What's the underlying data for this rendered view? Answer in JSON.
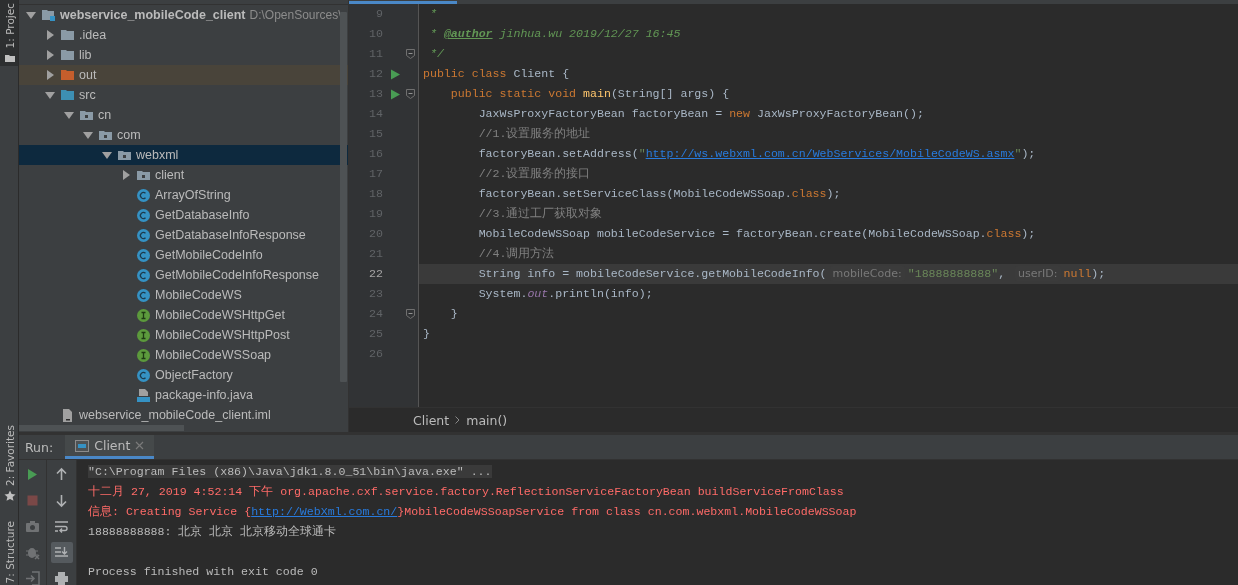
{
  "tool_windows": [
    {
      "label": "1: Projec",
      "selected": true
    },
    {
      "label": "2: Favorites",
      "selected": false
    },
    {
      "label": "7: Structure",
      "selected": false
    }
  ],
  "project_tree": {
    "children": [
      {
        "label": "webservice_mobileCode_client",
        "location": "D:\\OpenSources\\",
        "kind": "module",
        "expanded": true,
        "selected": false,
        "children": [
          {
            "label": ".idea",
            "kind": "folder",
            "expanded": false,
            "selected": false
          },
          {
            "label": "lib",
            "kind": "folder",
            "expanded": false,
            "selected": false
          },
          {
            "label": "out",
            "kind": "excluded-folder",
            "expanded": false,
            "selected": false
          },
          {
            "label": "src",
            "kind": "source-folder",
            "expanded": true,
            "selected": false,
            "children": [
              {
                "label": "cn",
                "kind": "package",
                "expanded": true,
                "selected": false,
                "children": [
                  {
                    "label": "com",
                    "kind": "package",
                    "expanded": true,
                    "selected": false,
                    "children": [
                      {
                        "label": "webxml",
                        "kind": "package",
                        "expanded": true,
                        "selected": true,
                        "children": [
                          {
                            "label": "client",
                            "kind": "package",
                            "expanded": false,
                            "selected": false
                          },
                          {
                            "label": "ArrayOfString",
                            "kind": "class",
                            "selected": false
                          },
                          {
                            "label": "GetDatabaseInfo",
                            "kind": "class",
                            "selected": false
                          },
                          {
                            "label": "GetDatabaseInfoResponse",
                            "kind": "class",
                            "selected": false
                          },
                          {
                            "label": "GetMobileCodeInfo",
                            "kind": "class",
                            "selected": false
                          },
                          {
                            "label": "GetMobileCodeInfoResponse",
                            "kind": "class",
                            "selected": false
                          },
                          {
                            "label": "MobileCodeWS",
                            "kind": "class",
                            "selected": false
                          },
                          {
                            "label": "MobileCodeWSHttpGet",
                            "kind": "interface",
                            "selected": false
                          },
                          {
                            "label": "MobileCodeWSHttpPost",
                            "kind": "interface",
                            "selected": false
                          },
                          {
                            "label": "MobileCodeWSSoap",
                            "kind": "interface",
                            "selected": false
                          },
                          {
                            "label": "ObjectFactory",
                            "kind": "class",
                            "selected": false
                          },
                          {
                            "label": "package-info.java",
                            "kind": "java-file",
                            "selected": false
                          }
                        ]
                      }
                    ]
                  }
                ]
              }
            ]
          },
          {
            "label": "webservice_mobileCode_client.iml",
            "kind": "iml-file",
            "selected": false
          }
        ]
      }
    ]
  },
  "editor": {
    "lines": [
      {
        "number": "9",
        "current": false,
        "run_marker": false,
        "fold_marker": false,
        "segments": [
          {
            "kind": "doc",
            "text": " *"
          }
        ]
      },
      {
        "number": "10",
        "current": false,
        "run_marker": false,
        "fold_marker": false,
        "segments": [
          {
            "kind": "doc",
            "text": " * "
          },
          {
            "kind": "doctag",
            "text": "@author"
          },
          {
            "kind": "doc",
            "text": " jinhua.wu 2019/12/27 16:45"
          }
        ]
      },
      {
        "number": "11",
        "current": false,
        "run_marker": false,
        "fold_marker": true,
        "segments": [
          {
            "kind": "doc",
            "text": " */"
          }
        ]
      },
      {
        "number": "12",
        "current": false,
        "run_marker": true,
        "fold_marker": false,
        "segments": [
          {
            "kind": "keyword",
            "text": "public class "
          },
          {
            "kind": "plain",
            "text": "Client {"
          }
        ]
      },
      {
        "number": "13",
        "current": false,
        "run_marker": true,
        "fold_marker": true,
        "segments": [
          {
            "kind": "keyword",
            "text": "    public static void "
          },
          {
            "kind": "method",
            "text": "main"
          },
          {
            "kind": "plain",
            "text": "(String[] args) {"
          }
        ]
      },
      {
        "number": "14",
        "current": false,
        "run_marker": false,
        "fold_marker": false,
        "segments": [
          {
            "kind": "plain",
            "text": "        JaxWsProxyFactoryBean factoryBean = "
          },
          {
            "kind": "keyword",
            "text": "new "
          },
          {
            "kind": "plain",
            "text": "JaxWsProxyFactoryBean();"
          }
        ]
      },
      {
        "number": "15",
        "current": false,
        "run_marker": false,
        "fold_marker": false,
        "segments": [
          {
            "kind": "comment",
            "text": "        //1.设置服务的地址"
          }
        ]
      },
      {
        "number": "16",
        "current": false,
        "run_marker": false,
        "fold_marker": false,
        "segments": [
          {
            "kind": "plain",
            "text": "        factoryBean.setAddress("
          },
          {
            "kind": "string",
            "text": "\""
          },
          {
            "kind": "link",
            "text": "http://ws.webxml.com.cn/WebServices/MobileCodeWS.asmx"
          },
          {
            "kind": "string",
            "text": "\""
          },
          {
            "kind": "plain",
            "text": ");"
          }
        ]
      },
      {
        "number": "17",
        "current": false,
        "run_marker": false,
        "fold_marker": false,
        "segments": [
          {
            "kind": "comment",
            "text": "        //2.设置服务的接口"
          }
        ]
      },
      {
        "number": "18",
        "current": false,
        "run_marker": false,
        "fold_marker": false,
        "segments": [
          {
            "kind": "plain",
            "text": "        factoryBean.setServiceClass(MobileCodeWSSoap."
          },
          {
            "kind": "keyword",
            "text": "class"
          },
          {
            "kind": "plain",
            "text": ");"
          }
        ]
      },
      {
        "number": "19",
        "current": false,
        "run_marker": false,
        "fold_marker": false,
        "segments": [
          {
            "kind": "comment",
            "text": "        //3.通过工厂获取对象"
          }
        ]
      },
      {
        "number": "20",
        "current": false,
        "run_marker": false,
        "fold_marker": false,
        "segments": [
          {
            "kind": "plain",
            "text": "        MobileCodeWSSoap mobileCodeService = factoryBean.create(MobileCodeWSSoap."
          },
          {
            "kind": "keyword",
            "text": "class"
          },
          {
            "kind": "plain",
            "text": ");"
          }
        ]
      },
      {
        "number": "21",
        "current": false,
        "run_marker": false,
        "fold_marker": false,
        "segments": [
          {
            "kind": "comment",
            "text": "        //4.调用方法"
          }
        ]
      },
      {
        "number": "22",
        "current": true,
        "run_marker": false,
        "fold_marker": false,
        "segments": [
          {
            "kind": "plain",
            "text": "        String info = mobileCodeService.getMobileCodeInfo("
          },
          {
            "kind": "hint",
            "text": "mobileCode:"
          },
          {
            "kind": "string",
            "text": "\"18888888888\""
          },
          {
            "kind": "plain",
            "text": ", "
          },
          {
            "kind": "hint",
            "text": "userID:"
          },
          {
            "kind": "keyword",
            "text": "null"
          },
          {
            "kind": "plain",
            "text": ");"
          }
        ]
      },
      {
        "number": "23",
        "current": false,
        "run_marker": false,
        "fold_marker": false,
        "segments": [
          {
            "kind": "plain",
            "text": "        System."
          },
          {
            "kind": "field",
            "text": "out"
          },
          {
            "kind": "plain",
            "text": ".println(info);"
          }
        ]
      },
      {
        "number": "24",
        "current": false,
        "run_marker": false,
        "fold_marker": true,
        "segments": [
          {
            "kind": "plain",
            "text": "    }"
          }
        ]
      },
      {
        "number": "25",
        "current": false,
        "run_marker": false,
        "fold_marker": false,
        "segments": [
          {
            "kind": "plain",
            "text": "}"
          }
        ]
      },
      {
        "number": "26",
        "current": false,
        "run_marker": false,
        "fold_marker": false
      }
    ],
    "breadcrumbs": [
      "Client",
      "main()"
    ]
  },
  "run_panel": {
    "label": "Run:",
    "tab": {
      "label": "Client",
      "selected": true
    },
    "left_toolbar": [
      {
        "kind": "run",
        "disabled": false
      },
      {
        "kind": "stop",
        "disabled": true
      },
      {
        "kind": "camera",
        "disabled": true
      },
      {
        "kind": "bug",
        "disabled": true
      },
      {
        "kind": "exit",
        "disabled": true
      }
    ],
    "right_toolbar": [
      {
        "kind": "up",
        "selected": false
      },
      {
        "kind": "down",
        "selected": false
      },
      {
        "kind": "wrap",
        "selected": false
      },
      {
        "kind": "scroll-end",
        "selected": true
      },
      {
        "kind": "print",
        "selected": false
      }
    ],
    "console": [
      {
        "kind": "command",
        "parts": [
          {
            "kind": "text",
            "text": "\"C:\\Program Files (x86)\\Java\\jdk1.8.0_51\\bin\\java.exe\" ..."
          }
        ]
      },
      {
        "kind": "error",
        "parts": [
          {
            "kind": "text",
            "text": "十二月 27, 2019 4:52:14 下午 org.apache.cxf.service.factory.ReflectionServiceFactoryBean buildServiceFromClass"
          }
        ]
      },
      {
        "kind": "error",
        "parts": [
          {
            "kind": "text",
            "text": "信息: Creating Service {"
          },
          {
            "kind": "link",
            "text": "http://WebXml.com.cn/"
          },
          {
            "kind": "text",
            "text": "}MobileCodeWSSoapService from class cn.com.webxml.MobileCodeWSSoap"
          }
        ]
      },
      {
        "kind": "output",
        "parts": [
          {
            "kind": "text",
            "text": "18888888888: 北京 北京 北京移动全球通卡"
          }
        ]
      },
      {
        "kind": "blank"
      },
      {
        "kind": "output",
        "parts": [
          {
            "kind": "text",
            "text": "Process finished with exit code 0"
          }
        ]
      }
    ]
  }
}
